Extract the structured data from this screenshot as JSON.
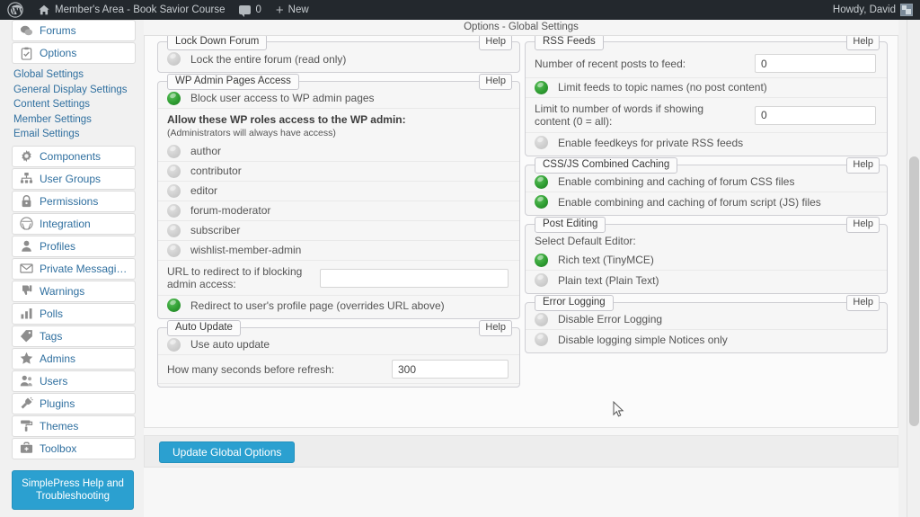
{
  "adminbar": {
    "logo_icon": "wordpress-logo-icon",
    "site_name": "Member's Area - Book Savior Course",
    "home_icon": "home-icon",
    "comments_icon": "comment-bubble-icon",
    "comments_count": "0",
    "new_icon": "plus-icon",
    "new_label": "New",
    "howdy": "Howdy, David",
    "avatar_icon": "user-avatar-icon"
  },
  "page": {
    "title": "Options - Global Settings"
  },
  "sidebar": {
    "nav": [
      {
        "label": "Forums",
        "icon": "forums-icon"
      },
      {
        "label": "Options",
        "icon": "options-clipboard-icon"
      }
    ],
    "sublinks": [
      "Global Settings",
      "General Display Settings",
      "Content Settings",
      "Member Settings",
      "Email Settings"
    ],
    "nav2": [
      {
        "label": "Components",
        "icon": "gear-icon"
      },
      {
        "label": "User Groups",
        "icon": "user-groups-icon"
      },
      {
        "label": "Permissions",
        "icon": "lock-icon"
      },
      {
        "label": "Integration",
        "icon": "wordpress-icon"
      },
      {
        "label": "Profiles",
        "icon": "profile-icon"
      },
      {
        "label": "Private Messaging",
        "icon": "envelope-icon"
      },
      {
        "label": "Warnings",
        "icon": "thumbs-down-icon"
      },
      {
        "label": "Polls",
        "icon": "bar-chart-icon"
      },
      {
        "label": "Tags",
        "icon": "tag-icon"
      },
      {
        "label": "Admins",
        "icon": "star-icon"
      },
      {
        "label": "Users",
        "icon": "users-icon"
      },
      {
        "label": "Plugins",
        "icon": "plug-icon"
      },
      {
        "label": "Themes",
        "icon": "paint-roller-icon"
      },
      {
        "label": "Toolbox",
        "icon": "toolbox-icon"
      }
    ],
    "help_button": "SimplePress Help and Troubleshooting"
  },
  "help_label": "Help",
  "panels": {
    "lock_down_forum": {
      "legend": "Lock Down Forum",
      "rows": [
        {
          "label": "Lock the entire forum (read only)",
          "state": "off"
        }
      ]
    },
    "wp_admin_pages_access": {
      "legend": "WP Admin Pages Access",
      "block_access": {
        "label": "Block user access to WP admin pages",
        "state": "on"
      },
      "roles_heading": "Allow these WP roles access to the WP admin:",
      "roles_note": "(Administrators will always have access)",
      "roles": [
        {
          "label": "author",
          "state": "off"
        },
        {
          "label": "contributor",
          "state": "off"
        },
        {
          "label": "editor",
          "state": "off"
        },
        {
          "label": "forum-moderator",
          "state": "off"
        },
        {
          "label": "subscriber",
          "state": "off"
        },
        {
          "label": "wishlist-member-admin",
          "state": "off"
        }
      ],
      "redirect_url_label": "URL to redirect to if blocking admin access:",
      "redirect_url_value": "",
      "redirect_url_placeholder": "",
      "redirect_profile": {
        "label": "Redirect to user's profile page (overrides URL above)",
        "state": "on"
      }
    },
    "auto_update": {
      "legend": "Auto Update",
      "use_auto_update": {
        "label": "Use auto update",
        "state": "off"
      },
      "refresh_label": "How many seconds before refresh:",
      "refresh_value": "300"
    },
    "rss_feeds": {
      "legend": "RSS Feeds",
      "recent_posts_label": "Number of recent posts to feed:",
      "recent_posts_value": "0",
      "limit_topic_names": {
        "label": "Limit feeds to topic names (no post content)",
        "state": "on"
      },
      "word_limit_label": "Limit to number of words if showing content (0 = all):",
      "word_limit_value": "0",
      "feedkeys": {
        "label": "Enable feedkeys for private RSS feeds",
        "state": "off"
      }
    },
    "css_js_caching": {
      "legend": "CSS/JS Combined Caching",
      "rows": [
        {
          "label": "Enable combining and caching of forum CSS files",
          "state": "on"
        },
        {
          "label": "Enable combining and caching of forum script (JS) files",
          "state": "on"
        }
      ]
    },
    "post_editing": {
      "legend": "Post Editing",
      "heading": "Select Default Editor:",
      "rows": [
        {
          "label": "Rich text (TinyMCE)",
          "state": "on"
        },
        {
          "label": "Plain text (Plain Text)",
          "state": "off"
        }
      ]
    },
    "error_logging": {
      "legend": "Error Logging",
      "rows": [
        {
          "label": "Disable Error Logging",
          "state": "off"
        },
        {
          "label": "Disable logging simple Notices only",
          "state": "off"
        }
      ]
    }
  },
  "footer": {
    "update_button": "Update Global Options"
  },
  "colors": {
    "accent": "#2ba0d0",
    "toggle_on": "#2f9e32",
    "toggle_off": "#cfcfcf",
    "adminbar": "#23282d",
    "link": "#2f6f9f"
  }
}
